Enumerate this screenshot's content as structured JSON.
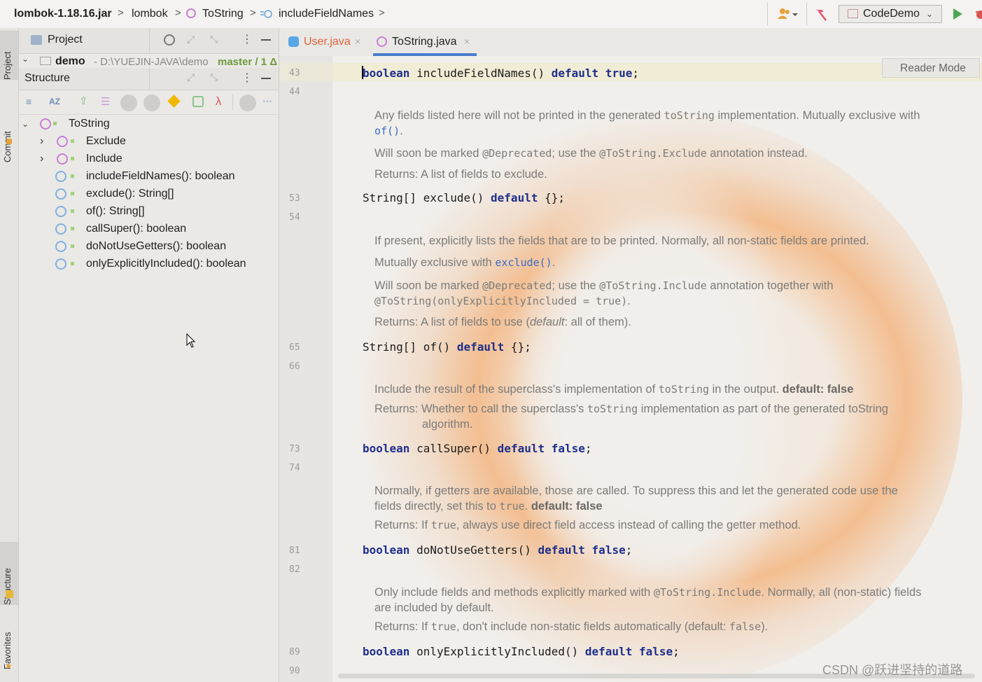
{
  "breadcrumb": {
    "items": [
      "lombok-1.18.16.jar",
      "lombok",
      "ToString",
      "includeFieldNames"
    ],
    "separator": ">"
  },
  "toolbar": {
    "run_config": "CodeDemo"
  },
  "left_strip": {
    "tabs": [
      "Project",
      "Commit",
      "Structure",
      "Favorites"
    ]
  },
  "project_panel": {
    "title": "Project",
    "root_name": "demo",
    "root_path": "- D:\\YUEJIN-JAVA\\demo",
    "root_vcs": "master / 1 Δ"
  },
  "structure_panel": {
    "title": "Structure",
    "items": [
      {
        "label": "ToString",
        "depth": 0,
        "expanded": true
      },
      {
        "label": "Exclude",
        "depth": 1,
        "expanded": false
      },
      {
        "label": "Include",
        "depth": 1,
        "expanded": false
      },
      {
        "label": "includeFieldNames(): boolean",
        "depth": 1
      },
      {
        "label": "exclude(): String[]",
        "depth": 1
      },
      {
        "label": "of(): String[]",
        "depth": 1
      },
      {
        "label": "callSuper(): boolean",
        "depth": 1
      },
      {
        "label": "doNotUseGetters(): boolean",
        "depth": 1
      },
      {
        "label": "onlyExplicitlyIncluded(): boolean",
        "depth": 1
      }
    ]
  },
  "editor": {
    "tabs": [
      {
        "label": "User.java",
        "active": false
      },
      {
        "label": "ToString.java",
        "active": true
      }
    ],
    "reader_mode": "Reader Mode",
    "line_numbers": [
      "43",
      "44",
      "53",
      "54",
      "65",
      "66",
      "73",
      "74",
      "81",
      "82",
      "89",
      "90"
    ],
    "code": {
      "l43": [
        "boolean",
        " includeFieldNames() ",
        "default",
        " ",
        "true",
        ";"
      ],
      "l53": [
        "String[] exclude() ",
        "default",
        " {};"
      ],
      "l65": [
        "String[] of() ",
        "default",
        " {};"
      ],
      "l73": [
        "boolean",
        " callSuper() ",
        "default",
        " ",
        "false",
        ";"
      ],
      "l81": [
        "boolean",
        " doNotUseGetters() ",
        "default",
        " ",
        "false",
        ";"
      ],
      "l89": [
        "boolean",
        " onlyExplicitlyIncluded() ",
        "default",
        " ",
        "false",
        ";"
      ]
    },
    "docs": {
      "exclude": {
        "p1a": "Any fields listed here will not be printed in the generated ",
        "p1code": "toString",
        "p1b": " implementation. Mutually exclusive with ",
        "p1link": "of()",
        "p1c": ".",
        "p2a": "Will soon be marked ",
        "p2code1": "@Deprecated",
        "p2b": "; use the ",
        "p2code2": "@ToString.Exclude",
        "p2c": " annotation instead.",
        "p3": "Returns: A list of fields to exclude."
      },
      "of": {
        "p1": "If present, explicitly lists the fields that are to be printed. Normally, all non-static fields are printed.",
        "p2a": "Mutually exclusive with ",
        "p2link": "exclude()",
        "p2b": ".",
        "p3a": "Will soon be marked ",
        "p3code1": "@Deprecated",
        "p3b": "; use the ",
        "p3code2": "@ToString.Include",
        "p3c": " annotation together with ",
        "p3code3": "@ToString(onlyExplicitlyIncluded = true)",
        "p3d": ".",
        "p4a": "Returns: A list of fields to use (",
        "p4em": "default",
        "p4b": ": all of them)."
      },
      "callSuper": {
        "p1a": "Include the result of the superclass's implementation of ",
        "p1code": "toString",
        "p1b": " in the output. ",
        "p1bold": "default: false",
        "p2a": "Returns: Whether to call the superclass's ",
        "p2code": "toString",
        "p2b": " implementation as part of the generated toString algorithm."
      },
      "doNotUseGetters": {
        "p1a": "Normally, if getters are available, those are called. To suppress this and let the generated code use the fields directly, set this to ",
        "p1code": "true",
        "p1b": ". ",
        "p1bold": "default: false",
        "p2a": "Returns: If ",
        "p2code": "true",
        "p2b": ", always use direct field access instead of calling the getter method."
      },
      "onlyExplicitlyIncluded": {
        "p1a": "Only include fields and methods explicitly marked with ",
        "p1code": "@ToString.Include",
        "p1b": ". Normally, all (non-static) fields are included by default.",
        "p2a": "Returns: If ",
        "p2code": "true",
        "p2b": ", don't include non-static fields automatically (default: ",
        "p2code2": "false",
        "p2c": ")."
      }
    },
    "watermark": "CSDN @跃进坚持的道路"
  },
  "colors": {
    "keyword": "#1f2f8c",
    "link": "#3a6dc6",
    "doc_text": "#7d7b78",
    "accent_tab": "#4b7ccc"
  }
}
